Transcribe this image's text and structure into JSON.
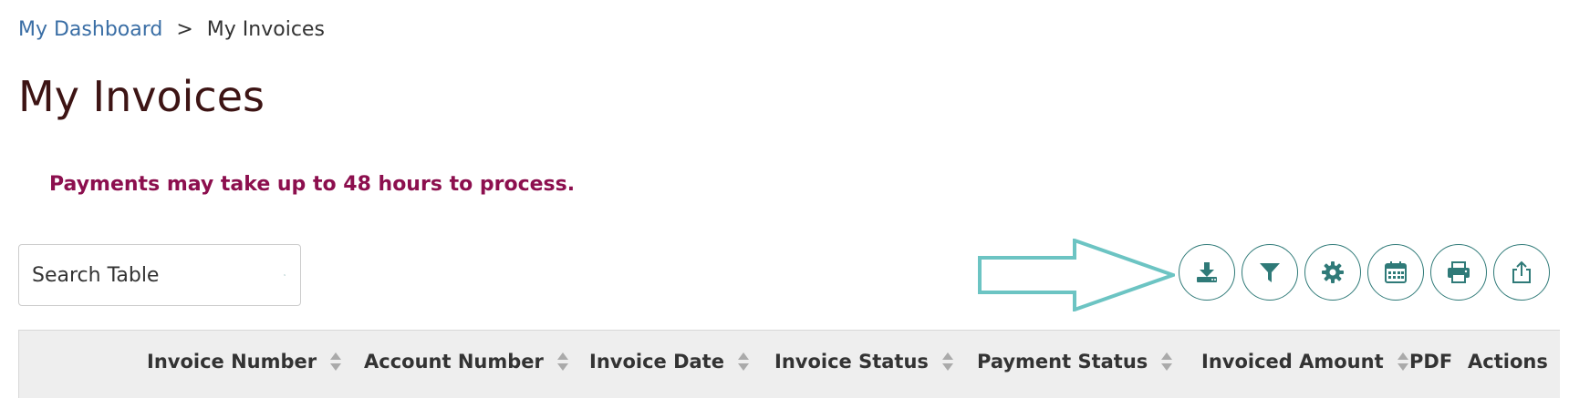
{
  "breadcrumb": {
    "home": "My Dashboard",
    "separator": ">",
    "current": "My Invoices"
  },
  "page": {
    "title": "My Invoices",
    "notice": "Payments may take up to 48 hours to process."
  },
  "search": {
    "placeholder": "Search Table",
    "value": ""
  },
  "toolbar": {
    "buttons": [
      {
        "icon": "download-icon"
      },
      {
        "icon": "filter-icon"
      },
      {
        "icon": "gear-icon"
      },
      {
        "icon": "calendar-icon"
      },
      {
        "icon": "printer-icon"
      },
      {
        "icon": "share-icon"
      }
    ]
  },
  "table": {
    "columns": [
      {
        "label": "Invoice Number",
        "sortable": true
      },
      {
        "label": "Account Number",
        "sortable": true
      },
      {
        "label": "Invoice Date",
        "sortable": true
      },
      {
        "label": "Invoice Status",
        "sortable": true
      },
      {
        "label": "Payment Status",
        "sortable": true
      },
      {
        "label": "Invoiced Amount",
        "sortable": true
      },
      {
        "label": "PDF",
        "sortable": false
      },
      {
        "label": "Actions",
        "sortable": false
      }
    ]
  },
  "colors": {
    "link": "#3a6ea5",
    "title": "#3d1414",
    "notice": "#8c0f4e",
    "accent": "#2f7a78",
    "callout": "#6cc4c3",
    "table_header_bg": "#eeeeee"
  }
}
